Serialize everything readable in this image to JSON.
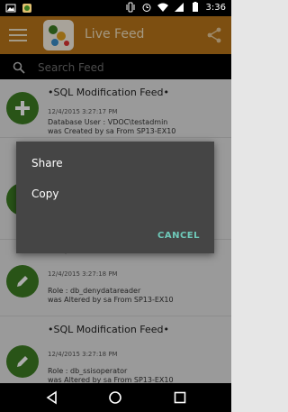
{
  "status_bar": {
    "time": "3:36",
    "left_icons": [
      "image-icon",
      "notification-app-icon"
    ],
    "right_icons": [
      "vibrate-icon",
      "alarm-icon",
      "wifi-icon",
      "signal-icon",
      "battery-icon"
    ]
  },
  "app_bar": {
    "title": "Live Feed",
    "menu_icon": "hamburger-icon",
    "share_icon": "share-icon"
  },
  "search": {
    "placeholder": "Search Feed"
  },
  "feed": {
    "items": [
      {
        "title": "•SQL Modification Feed•",
        "timestamp": "12/4/2015 3:27:17 PM",
        "line1": "Database User : VDOC\\testadmin",
        "line2": "was Created by sa From SP13-EX10",
        "icon": "plus-icon"
      },
      {
        "title": "",
        "timestamp": "",
        "line1": "",
        "line2": "",
        "icon": "pencil-icon"
      },
      {
        "title": "•SQL Modification Feed•",
        "timestamp": "12/4/2015 3:27:18 PM",
        "line1": "Role : db_denydatareader",
        "line2": "was Altered by sa From SP13-EX10",
        "icon": "pencil-icon"
      },
      {
        "title": "•SQL Modification Feed•",
        "timestamp": "12/4/2015 3:27:18 PM",
        "line1": "Role : db_ssisoperator",
        "line2": "was Altered by sa From SP13-EX10",
        "icon": "pencil-icon"
      }
    ]
  },
  "dialog": {
    "options": [
      "Share",
      "Copy"
    ],
    "cancel_label": "CANCEL"
  },
  "colors": {
    "app_bar": "#b8751a",
    "avatar": "#3d7d23",
    "dialog_bg": "#454545",
    "cancel_text": "#6ec9b9"
  }
}
